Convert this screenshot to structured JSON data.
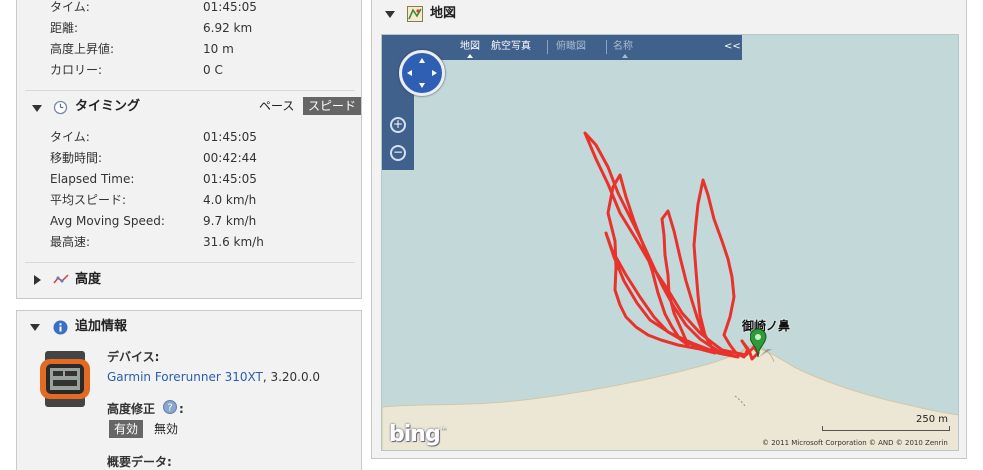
{
  "summary": {
    "rows": [
      {
        "label": "タイム:",
        "value": "01:45:05"
      },
      {
        "label": "距離:",
        "value": "6.92 km"
      },
      {
        "label": "高度上昇値:",
        "value": "10 m"
      },
      {
        "label": "カロリー:",
        "value": "0 C"
      }
    ]
  },
  "timing": {
    "title": "タイミング",
    "pace_label": "ペース",
    "speed_label": "スピード",
    "rows": [
      {
        "label": "タイム:",
        "value": "01:45:05"
      },
      {
        "label": "移動時間:",
        "value": "00:42:44"
      },
      {
        "label": "Elapsed Time:",
        "value": "01:45:05"
      },
      {
        "label": "平均スピード:",
        "value": "4.0 km/h"
      },
      {
        "label": "Avg Moving Speed:",
        "value": "9.7 km/h"
      },
      {
        "label": "最高速:",
        "value": "31.6 km/h"
      }
    ]
  },
  "elevation": {
    "title": "高度"
  },
  "additional": {
    "title": "追加情報",
    "device_label": "デバイス:",
    "device_name": "Garmin Forerunner 310XT",
    "device_version": ", 3.20.0.0",
    "elev_correction_label": "高度修正",
    "on_label": "有効",
    "off_label": "無効",
    "summary_data_label": "概要データ:"
  },
  "map": {
    "title": "地図",
    "tabs": {
      "map": "地図",
      "aerial": "航空写真",
      "birdseye": "俯瞰図",
      "labels": "名称"
    },
    "collapse": "<<",
    "place_label": "御崎ノ鼻",
    "scale": "250 m",
    "copyright": "© 2011 Microsoft Corporation   © AND   © 2010 Zenrin",
    "provider": "bing",
    "track_color": "#e8322c"
  }
}
